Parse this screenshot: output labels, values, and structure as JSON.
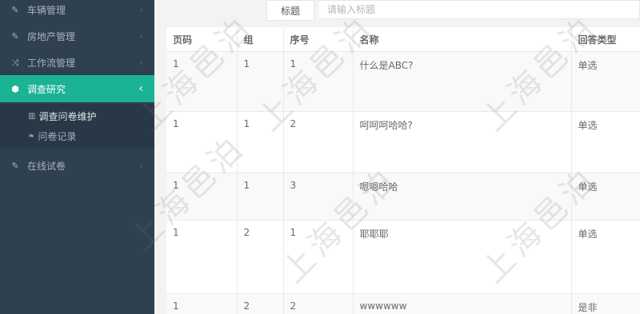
{
  "sidebar": {
    "items": [
      {
        "label": "车辆管理",
        "icon": "edit-icon"
      },
      {
        "label": "房地产管理",
        "icon": "edit-icon"
      },
      {
        "label": "工作流管理",
        "icon": "shuffle-icon"
      },
      {
        "label": "调查研究",
        "icon": "cube-icon"
      },
      {
        "label": "在线试卷",
        "icon": "edit-icon"
      }
    ],
    "submenu": [
      {
        "label": "调查问卷维护",
        "icon": "book-icon"
      },
      {
        "label": "问卷记录",
        "icon": "leaf-icon"
      }
    ]
  },
  "search": {
    "label": "标题",
    "placeholder": "请输入标题"
  },
  "table": {
    "headers": [
      "页码",
      "组",
      "序号",
      "名称",
      "回答类型"
    ],
    "rows": [
      [
        "1",
        "1",
        "1",
        "什么是ABC?",
        "单选"
      ],
      [
        "1",
        "1",
        "2",
        "呵呵呵哈哈?",
        "单选"
      ],
      [
        "1",
        "1",
        "3",
        "嗯嗯哈哈",
        "单选"
      ],
      [
        "1",
        "2",
        "1",
        "耶耶耶",
        "单选"
      ],
      [
        "1",
        "2",
        "2",
        "wwwwww",
        "是非"
      ]
    ]
  },
  "watermark": "上海邑泊",
  "colors": {
    "sidebar": "#2f4050",
    "active": "#1ab394"
  }
}
